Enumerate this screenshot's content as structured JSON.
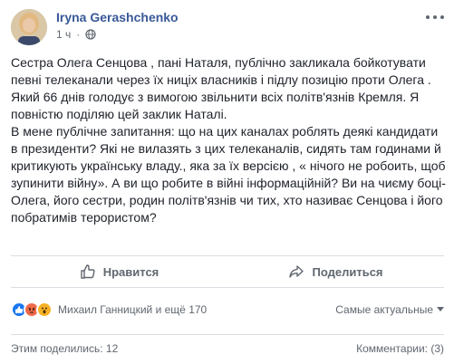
{
  "post": {
    "author": "Iryna Gerashchenko",
    "time": "1 ч",
    "paragraphs": [
      "Сестра Олега Сенцова , пані Наталя, публічно закликала бойкотувати певні телеканали через їх ниціх власників і підлу позицію проти Олега . Який 66 днів голодує з вимогою звільнити всіх політв'язнів Кремля. Я повністю поділяю цей заклик Наталі.",
      "В мене публічне запитання: що на цих каналах роблять деякі кандидати в президенти? Які не вилазять з цих телеканалів, сидять там годинами й критикують українську владу., яка за їх версією , « нічого не робоить, щоб зупинити війну». А ви що робите в війні інформаційній? Ви на чиєму боці- Олега, його сестри, родин політв'язнів чи тих, хто називає Сенцова і його побратимів терористом?"
    ]
  },
  "actions": {
    "like": "Нравится",
    "share": "Поделиться"
  },
  "reactions": {
    "text": "Михаил Ганницкий и ещё 170",
    "sort": "Самые актуальные",
    "colors": {
      "like": "#1877f2",
      "angry": "#f06a4a",
      "wow": "#f7b125"
    }
  },
  "footer": {
    "shares": "Этим поделились: 12",
    "comments": "Комментарии: (3)"
  }
}
